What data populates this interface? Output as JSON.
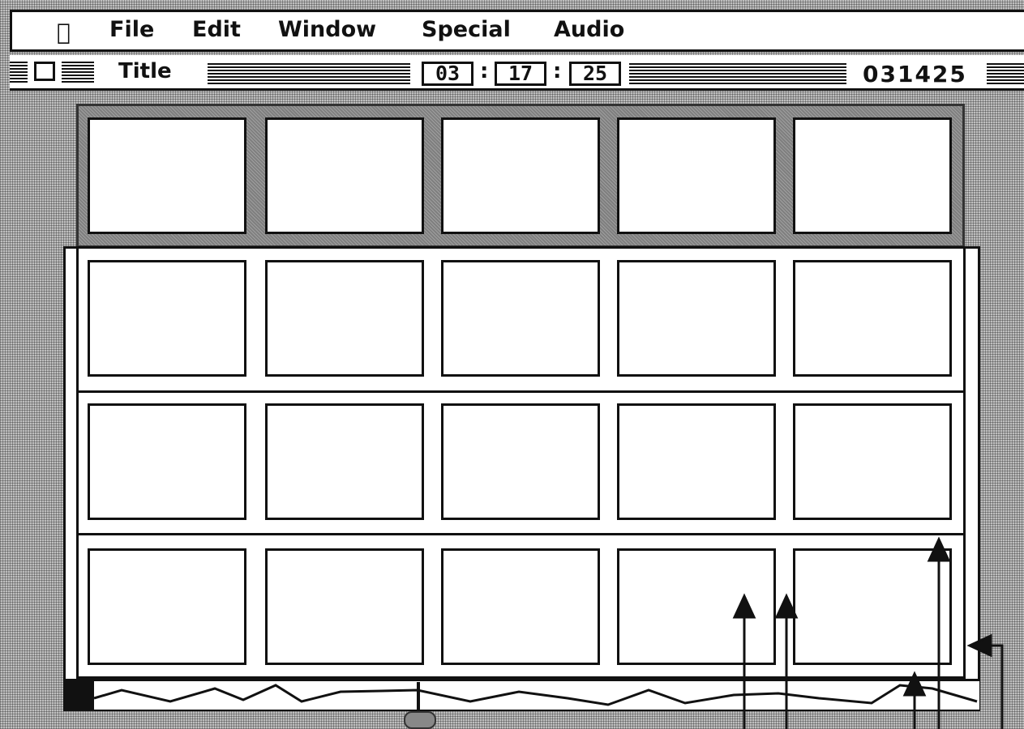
{
  "menubar": {
    "apple_symbol": "",
    "items": [
      "File",
      "Edit",
      "Window",
      "Special",
      "Audio"
    ]
  },
  "window": {
    "title": "Title",
    "timecode": {
      "hours": "03",
      "minutes": "17",
      "seconds": "25",
      "separator": ":"
    },
    "frame_counter": "031425"
  },
  "storyboard": {
    "rows": 4,
    "columns": 5,
    "highlighted_row": 1
  },
  "icons": {
    "apple": "apple-logo-icon",
    "close": "close-box-icon",
    "scroll_thumb": "scroll-thumb-icon"
  },
  "colors": {
    "desktop": "#bfbfbf",
    "ink": "#111111",
    "highlight_row": "#7f7f7f",
    "scroll_thumb": "#888888"
  }
}
